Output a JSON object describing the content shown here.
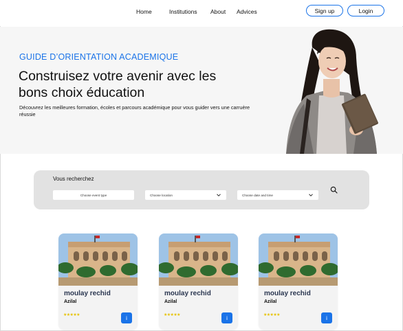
{
  "nav": {
    "links": [
      "Home",
      "Institutions",
      "About",
      "Advices"
    ],
    "signup_label": "Sign up",
    "login_label": "Login"
  },
  "hero": {
    "eyebrow": "GUIDE D’ORIENTATION ACADEMIQUE",
    "title": "Construisez votre avenir avec les bons choix éducation",
    "description": "Découvrez les meilleures formation, écoles et parcours académique pour vous guider vers une  carruère réussie"
  },
  "search": {
    "title": "Vous recherchez",
    "event_type_placeholder": "Choose event type",
    "location_placeholder": "Choose location",
    "date_placeholder": "Choose date and time",
    "icon": "search-icon"
  },
  "cards": [
    {
      "name": "moulay rechid",
      "location": "Azilal",
      "stars": "★★★★★",
      "info_label": "i"
    },
    {
      "name": "moulay rechid",
      "location": "Azilal",
      "stars": "★★★★★",
      "info_label": "i"
    },
    {
      "name": "moulay rechid",
      "location": "Azilal",
      "stars": "★★★★★",
      "info_label": "i"
    }
  ],
  "colors": {
    "accent": "#1a73e8",
    "hero_bg": "#f6f6f6",
    "search_bg": "#e2e2e2",
    "card_title": "#2a3650",
    "stars": "#e6c200"
  }
}
